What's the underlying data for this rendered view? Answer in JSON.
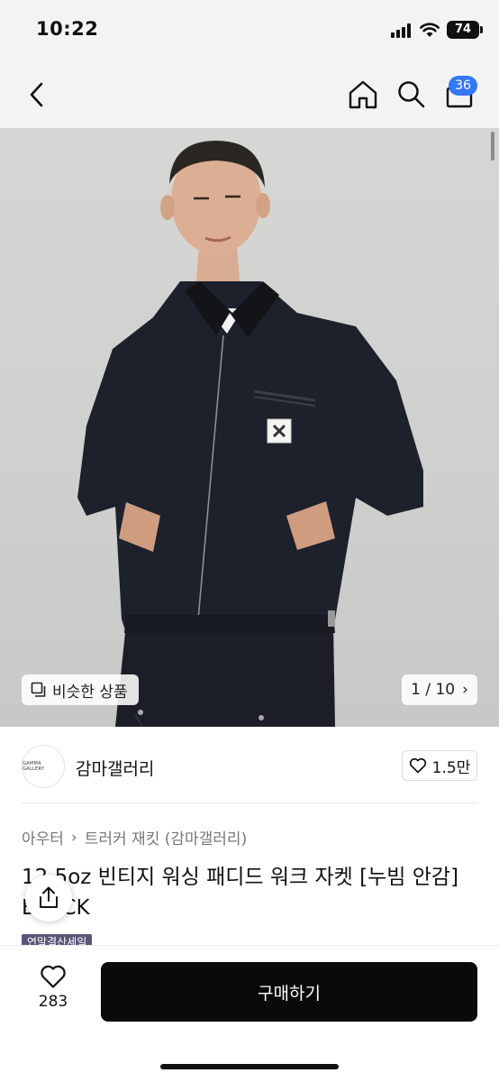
{
  "status_bar": {
    "time": "10:22",
    "battery": "74"
  },
  "nav": {
    "cart_count": "36"
  },
  "gallery": {
    "similar_label": "비슷한 상품",
    "pager": "1 / 10",
    "pager_arrow": "›"
  },
  "shop": {
    "logo_text": "GAMMA GALLERY",
    "name": "감마갤러리",
    "likes": "1.5만"
  },
  "breadcrumb": {
    "category": "아우터",
    "separator": "›",
    "subcategory": "트러커 재킷 (감마갤러리)"
  },
  "product": {
    "title": "12.5oz 빈티지 워싱 패디드 워크 자켓 [누빔 안감] BLACK",
    "badge": "연말결산세일"
  },
  "bottom_bar": {
    "wish_count": "283",
    "buy_label": "구매하기"
  },
  "colors": {
    "accent_badge": "#3478f6",
    "buy_button": "#0a0a0a",
    "sale_badge": "#5d5479",
    "jacket": "#1d212b"
  },
  "icons": [
    "back-icon",
    "home-icon",
    "search-icon",
    "shopping-bag-icon",
    "similar-products-icon",
    "heart-icon",
    "share-icon",
    "chevron-right-icon"
  ]
}
